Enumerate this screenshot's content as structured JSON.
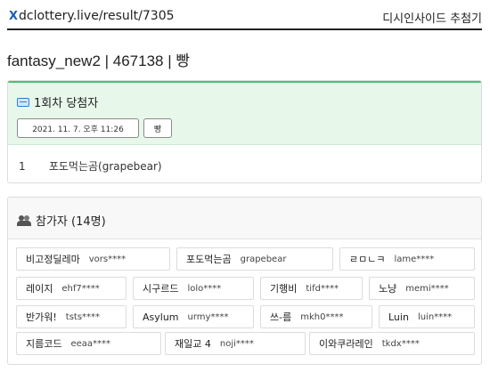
{
  "header": {
    "brand_mark": "X",
    "url": "dclottery.live/result/7305",
    "site_title": "디시인사이드 추첨기"
  },
  "page_title": "fantasy_new2 | 467138 | 빵",
  "winners": {
    "title": "1회차 당첨자",
    "date": "2021. 11. 7. 오후 11:26",
    "tag": "빵",
    "list": [
      {
        "rank": "1",
        "name": "포도먹는곰(grapebear)"
      }
    ]
  },
  "participants": {
    "title": "참가자 (14명)",
    "list": [
      {
        "name": "비고정딜레마",
        "id": "vors****"
      },
      {
        "name": "포도먹는곰",
        "id": "grapebear"
      },
      {
        "name": "ㄹㅁㄴㅋ",
        "id": "lame****"
      },
      {
        "name": "레이지",
        "id": "ehf7****"
      },
      {
        "name": "시구르드",
        "id": "lolo****"
      },
      {
        "name": "기행비",
        "id": "tifd****"
      },
      {
        "name": "노냥",
        "id": "memi****"
      },
      {
        "name": "반가워!",
        "id": "tsts****"
      },
      {
        "name": "Asylum",
        "id": "urmy****"
      },
      {
        "name": "쓰-름",
        "id": "mkh0****"
      },
      {
        "name": "Luin",
        "id": "luin****"
      },
      {
        "name": "지름코드",
        "id": "eeaa****"
      },
      {
        "name": "재일교 4",
        "id": "noji****"
      },
      {
        "name": "이와쿠라레인",
        "id": "tkdx****"
      }
    ]
  },
  "colors": {
    "accent_green": "#4cc26e",
    "winner_bg": "#e7f7ea",
    "brand_blue": "#1a5fb4"
  },
  "icons": {
    "winners": "id-card-icon",
    "participants": "users-icon"
  }
}
